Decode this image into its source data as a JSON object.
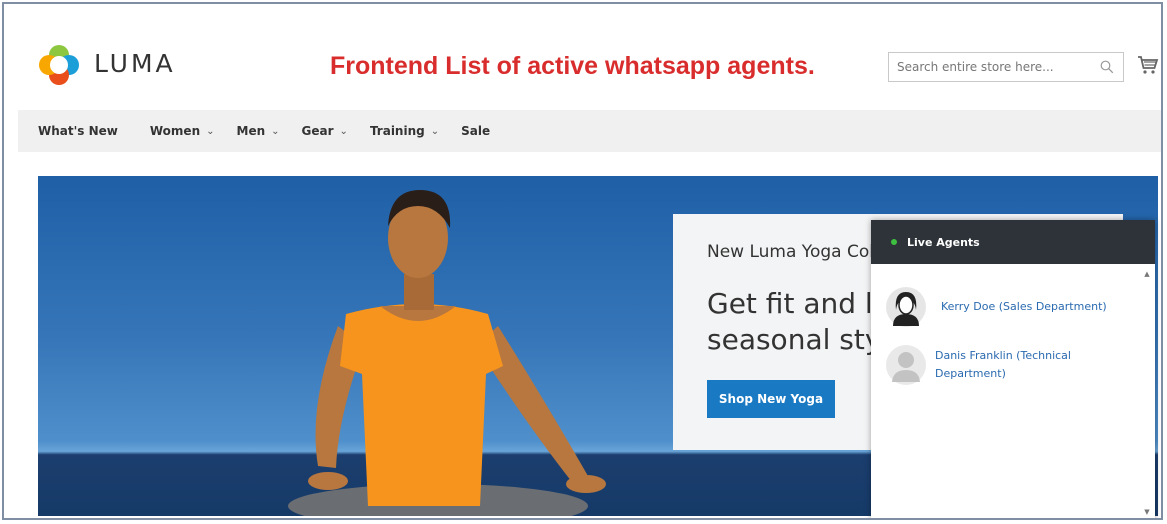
{
  "brand": {
    "name": "LUMA"
  },
  "caption": "Frontend List of active whatsapp agents.",
  "search": {
    "placeholder": "Search entire store here..."
  },
  "nav": {
    "items": [
      {
        "label": "What's New",
        "has_dropdown": false
      },
      {
        "label": "Women",
        "has_dropdown": true
      },
      {
        "label": "Men",
        "has_dropdown": true
      },
      {
        "label": "Gear",
        "has_dropdown": true
      },
      {
        "label": "Training",
        "has_dropdown": true
      },
      {
        "label": "Sale",
        "has_dropdown": false
      }
    ]
  },
  "hero": {
    "subtitle": "New Luma Yoga Collection",
    "title": "Get fit and look fab in new seasonal styles",
    "button_label": "Shop New Yoga"
  },
  "live_agents": {
    "title": "Live Agents",
    "status_color": "#3fbf3f",
    "agents": [
      {
        "name": "Kerry Doe (Sales Department)",
        "avatar": "female-avatar-icon"
      },
      {
        "name": "Danis Franklin (Technical Department)",
        "avatar": "male-avatar-icon"
      }
    ]
  },
  "colors": {
    "accent": "#1979c3",
    "caption": "#d92c2c",
    "panel_header": "#2d3338"
  }
}
